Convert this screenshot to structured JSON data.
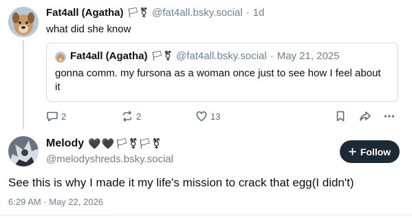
{
  "reply_post": {
    "author_name": "Fat4all (Agatha)",
    "author_flags": "🏳⚧",
    "author_handle": "@fat4all.bsky.social",
    "separator": "·",
    "time_ago": "1d",
    "text": "what did she know"
  },
  "quoted_post": {
    "author_name": "Fat4all (Agatha)",
    "author_flags": "🏳⚧",
    "author_handle": "@fat4all.bsky.social",
    "separator": "·",
    "date": "May 21, 2025",
    "text": "gonna comm. my fursona as a woman once just to see how I feel about it"
  },
  "reply_actions": {
    "reply_count": "2",
    "repost_count": "2",
    "like_count": "13",
    "icons": [
      "reply-icon",
      "repost-icon",
      "like-icon",
      "bookmark-icon",
      "share-icon",
      "more-icon"
    ]
  },
  "main_post": {
    "author_name": "Melody",
    "author_badges": "🖤🖤🏳⚧🏳⚧",
    "author_handle": "@melodyshreds.bsky.social",
    "follow_label": "Follow",
    "text": "See this is why I made it my life's mission to crack that egg(I didn't)",
    "timestamp": "6:29 AM · May 22, 2026"
  },
  "colors": {
    "text": "#0b0f14",
    "muted": "#6f7f90",
    "border": "#d4dbe2",
    "follow_bg": "#1e2936"
  }
}
